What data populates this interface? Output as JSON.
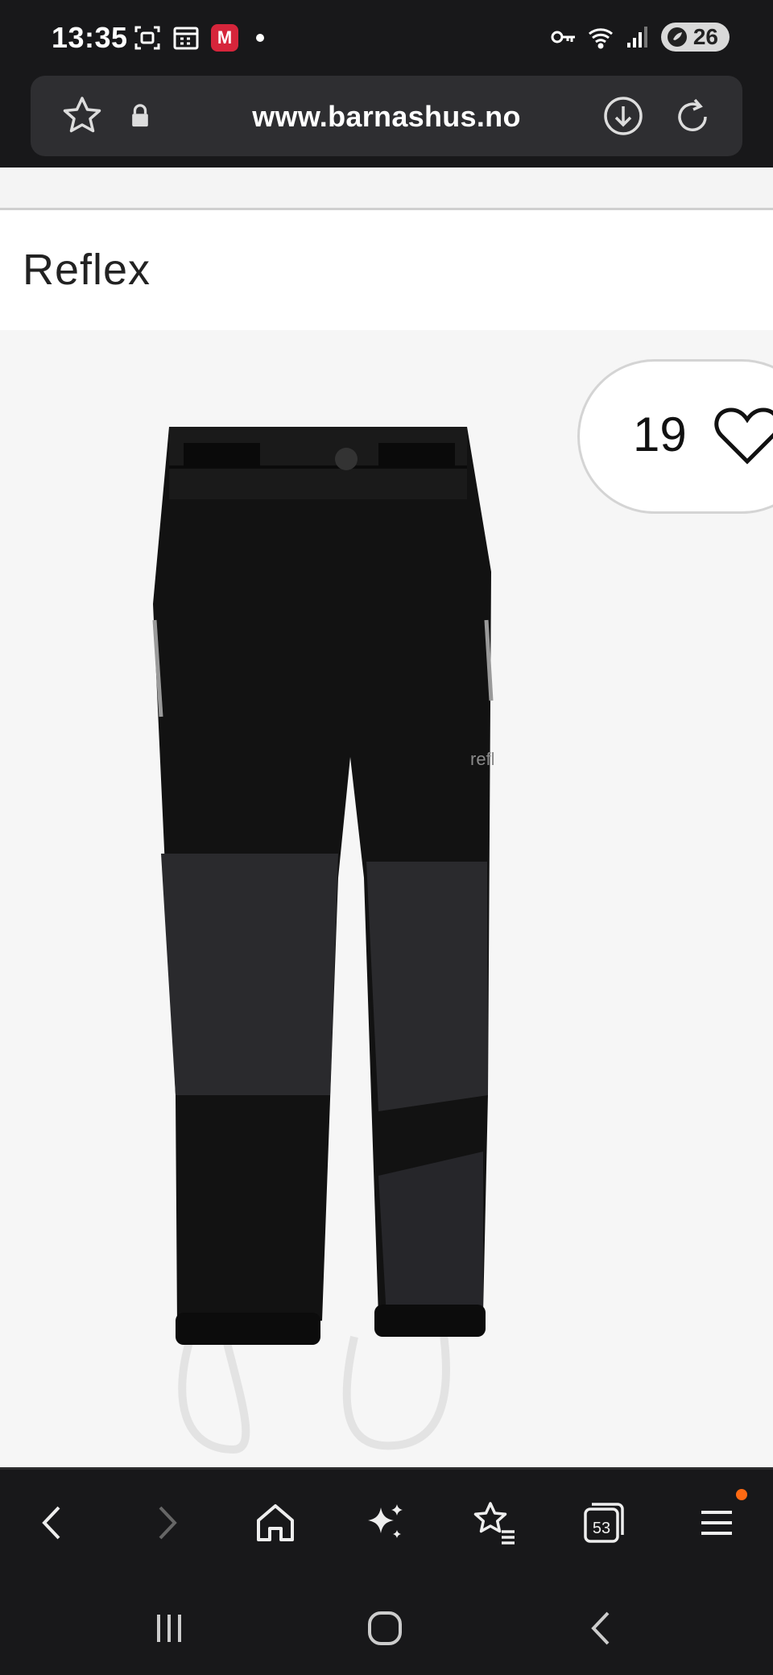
{
  "status_bar": {
    "time": "13:35",
    "mail_letter": "M",
    "battery": "26",
    "icons": [
      "screenshot-icon",
      "calendar-icon",
      "mail-app-icon",
      "key-icon",
      "wifi-icon",
      "signal-icon",
      "battery-icon"
    ]
  },
  "browser": {
    "url": "www.barnashus.no",
    "icons": [
      "bookmark-star-icon",
      "lock-icon",
      "download-icon",
      "reload-icon"
    ]
  },
  "page": {
    "brand": "Reflex",
    "favorites_count": "19"
  },
  "bottom_nav": {
    "tabs_count": "53",
    "items": [
      "back",
      "forward",
      "home",
      "ai-assistant",
      "bookmarks",
      "tabs",
      "menu"
    ],
    "notification_color": "#ff6a13"
  },
  "system_nav": {
    "items": [
      "recent-apps",
      "home",
      "back"
    ]
  },
  "colors": {
    "chrome": "#18181a",
    "url_bar": "#2e2e31",
    "product_bg": "#f6f6f6"
  }
}
